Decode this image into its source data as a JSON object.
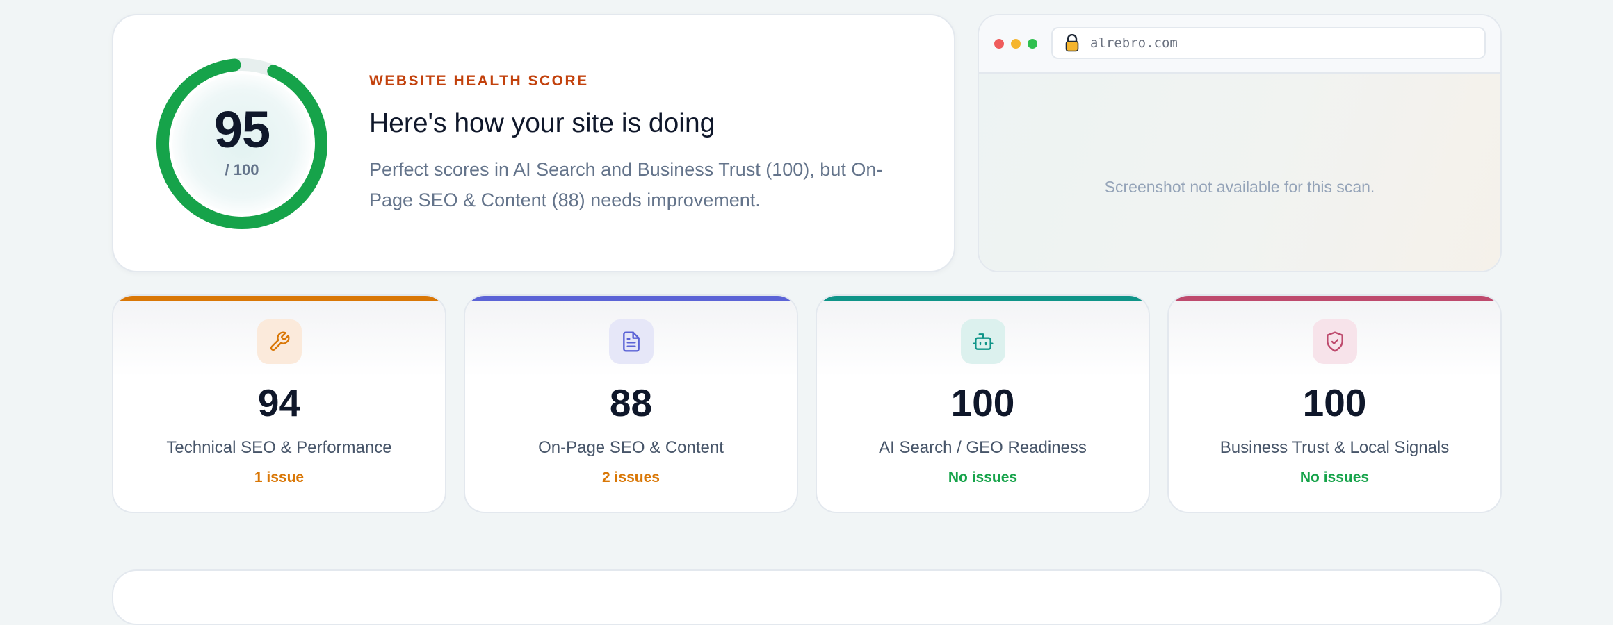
{
  "health": {
    "score": "95",
    "max": "/ 100",
    "score_fraction": 0.95,
    "eyebrow": "WEBSITE HEALTH SCORE",
    "heading": "Here's how your site is doing",
    "description": "Perfect scores in AI Search and Business Trust (100), but On-Page SEO & Content (88) needs improvement.",
    "gauge_color": "#16a34a",
    "gauge_track": "#e7efee"
  },
  "screenshot": {
    "url": "alrebro.com",
    "message": "Screenshot not available for this scan."
  },
  "categories": [
    {
      "score": "94",
      "name": "Technical SEO & Performance",
      "status": "1 issue",
      "icon": "wrench-icon",
      "accent": "#d97706",
      "icon_bg": "#fbeadb",
      "status_color": "#d97706"
    },
    {
      "score": "88",
      "name": "On-Page SEO & Content",
      "status": "2 issues",
      "icon": "document-icon",
      "accent": "#5b63d6",
      "icon_bg": "#e6e7f8",
      "status_color": "#d97706"
    },
    {
      "score": "100",
      "name": "AI Search / GEO Readiness",
      "status": "No issues",
      "icon": "robot-icon",
      "accent": "#0f9488",
      "icon_bg": "#dcf1ee",
      "status_color": "#16a34a"
    },
    {
      "score": "100",
      "name": "Business Trust & Local Signals",
      "status": "No issues",
      "icon": "shield-check-icon",
      "accent": "#be4a6d",
      "icon_bg": "#f7e3ea",
      "status_color": "#16a34a"
    }
  ]
}
